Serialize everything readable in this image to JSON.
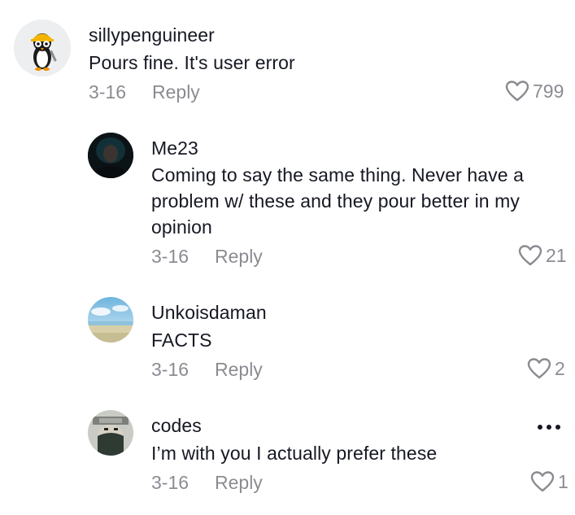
{
  "colors": {
    "text_primary": "#161823",
    "text_secondary": "#8a8b91"
  },
  "comments": [
    {
      "username": "sillypenguineer",
      "text": "Pours fine. It's user error",
      "date": "3-16",
      "reply_label": "Reply",
      "likes": "799",
      "avatar_icon": "penguin-engineer-avatar"
    },
    {
      "username": "Me23",
      "text": "Coming to say the same thing. Never have a problem w/ these and they pour better in my opinion",
      "date": "3-16",
      "reply_label": "Reply",
      "likes": "21",
      "avatar_icon": "dark-photo-avatar"
    },
    {
      "username": "Unkoisdaman",
      "text": "FACTS",
      "date": "3-16",
      "reply_label": "Reply",
      "likes": "2",
      "avatar_icon": "beach-photo-avatar"
    },
    {
      "username": "codes",
      "text": "I’m with you I actually prefer these",
      "date": "3-16",
      "reply_label": "Reply",
      "likes": "1",
      "avatar_icon": "masked-face-avatar"
    }
  ]
}
